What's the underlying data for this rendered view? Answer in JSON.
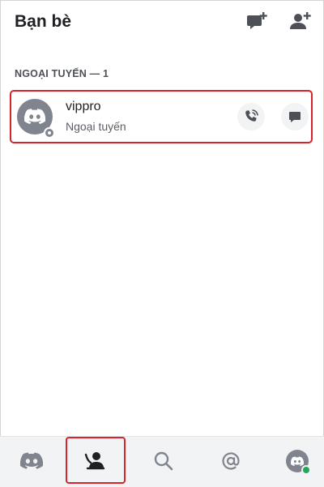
{
  "header": {
    "title": "Bạn bè"
  },
  "friends_section": {
    "label": "NGOẠI TUYẾN — 1"
  },
  "friends": [
    {
      "name": "vippro",
      "status": "Ngoại tuyến"
    }
  ],
  "icons": {
    "new_dm": "new-message-icon",
    "add_friend": "add-friend-icon",
    "call": "voice-call-icon",
    "message": "message-icon",
    "home": "discord-logo-icon",
    "friends_tab": "friends-wave-icon",
    "search": "search-icon",
    "mentions": "at-mention-icon"
  },
  "colors": {
    "highlight_border": "#d8232a",
    "avatar_gray": "#80848e",
    "online_green": "#23a55a",
    "text_primary": "#1f2023"
  }
}
